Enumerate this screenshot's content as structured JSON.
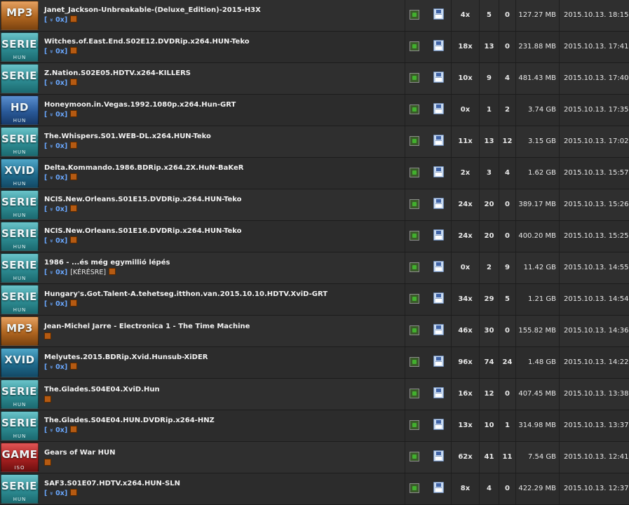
{
  "torrents": [
    {
      "cat": "MP3",
      "sub": "",
      "cls": "mp3",
      "name": "Janet_Jackson-Unbreakable-(Deluxe_Edition)-2015-H3X",
      "dl": "0x",
      "req": "",
      "downloads": "4x",
      "seeders": "5",
      "leechers": "0",
      "size": "127.27 MB",
      "date": "2015.10.13. 18:15"
    },
    {
      "cat": "SERIES",
      "sub": "HUN",
      "cls": "series",
      "name": "Witches.of.East.End.S02E12.DVDRip.x264.HUN-Teko",
      "dl": "0x",
      "req": "",
      "downloads": "18x",
      "seeders": "13",
      "leechers": "0",
      "size": "231.88 MB",
      "date": "2015.10.13. 17:41"
    },
    {
      "cat": "SERIES",
      "sub": "",
      "cls": "series",
      "name": "Z.Nation.S02E05.HDTV.x264-KILLERS",
      "dl": "0x",
      "req": "",
      "downloads": "10x",
      "seeders": "9",
      "leechers": "4",
      "size": "481.43 MB",
      "date": "2015.10.13. 17:40"
    },
    {
      "cat": "HD",
      "sub": "HUN",
      "cls": "hd",
      "name": "Honeymoon.in.Vegas.1992.1080p.x264.Hun-GRT",
      "dl": "0x",
      "req": "",
      "downloads": "0x",
      "seeders": "1",
      "leechers": "2",
      "size": "3.74 GB",
      "date": "2015.10.13. 17:35"
    },
    {
      "cat": "SERIES",
      "sub": "HUN",
      "cls": "series",
      "name": "The.Whispers.S01.WEB-DL.x264.HUN-Teko",
      "dl": "0x",
      "req": "",
      "downloads": "11x",
      "seeders": "13",
      "leechers": "12",
      "size": "3.15 GB",
      "date": "2015.10.13. 17:02"
    },
    {
      "cat": "XVID",
      "sub": "HUN",
      "cls": "xvid",
      "name": "Delta.Kommando.1986.BDRip.x264.2X.HuN-BaKeR",
      "dl": "0x",
      "req": "",
      "downloads": "2x",
      "seeders": "3",
      "leechers": "4",
      "size": "1.62 GB",
      "date": "2015.10.13. 15:57"
    },
    {
      "cat": "SERIES",
      "sub": "HUN",
      "cls": "series",
      "name": "NCIS.New.Orleans.S01E15.DVDRip.x264.HUN-Teko",
      "dl": "0x",
      "req": "",
      "downloads": "24x",
      "seeders": "20",
      "leechers": "0",
      "size": "389.17 MB",
      "date": "2015.10.13. 15:26"
    },
    {
      "cat": "SERIES",
      "sub": "HUN",
      "cls": "series",
      "name": "NCIS.New.Orleans.S01E16.DVDRip.x264.HUN-Teko",
      "dl": "0x",
      "req": "",
      "downloads": "24x",
      "seeders": "20",
      "leechers": "0",
      "size": "400.20 MB",
      "date": "2015.10.13. 15:25"
    },
    {
      "cat": "SERIES",
      "sub": "HUN",
      "cls": "series",
      "name": "1986 - ...és még egymillió lépés",
      "dl": "0x",
      "req": "[KÉRÉSRE]",
      "downloads": "0x",
      "seeders": "2",
      "leechers": "9",
      "size": "11.42 GB",
      "date": "2015.10.13. 14:55"
    },
    {
      "cat": "SERIES",
      "sub": "HUN",
      "cls": "series",
      "name": "Hungary's.Got.Talent-A.tehetseg.itthon.van.2015.10.10.HDTV.XviD-GRT",
      "dl": "0x",
      "req": "",
      "downloads": "34x",
      "seeders": "29",
      "leechers": "5",
      "size": "1.21 GB",
      "date": "2015.10.13. 14:54"
    },
    {
      "cat": "MP3",
      "sub": "",
      "cls": "mp3",
      "name": "Jean-Michel Jarre - Electronica 1 - The Time Machine",
      "dl": "",
      "req": "",
      "downloads": "46x",
      "seeders": "30",
      "leechers": "0",
      "size": "155.82 MB",
      "date": "2015.10.13. 14:36"
    },
    {
      "cat": "XVID",
      "sub": "",
      "cls": "xvid",
      "name": "Melyutes.2015.BDRip.Xvid.Hunsub-XiDER",
      "dl": "0x",
      "req": "",
      "downloads": "96x",
      "seeders": "74",
      "leechers": "24",
      "size": "1.48 GB",
      "date": "2015.10.13. 14:22"
    },
    {
      "cat": "SERIES",
      "sub": "HUN",
      "cls": "series",
      "name": "The.Glades.S04E04.XviD.Hun",
      "dl": "",
      "req": "",
      "downloads": "16x",
      "seeders": "12",
      "leechers": "0",
      "size": "407.45 MB",
      "date": "2015.10.13. 13:38"
    },
    {
      "cat": "SERIES",
      "sub": "HUN",
      "cls": "series",
      "name": "The.Glades.S04E04.HUN.DVDRip.x264-HNZ",
      "dl": "0x",
      "req": "",
      "downloads": "13x",
      "seeders": "10",
      "leechers": "1",
      "size": "314.98 MB",
      "date": "2015.10.13. 13:37"
    },
    {
      "cat": "GAME",
      "sub": "ISO",
      "cls": "game",
      "name": "Gears of War HUN",
      "dl": "",
      "req": "",
      "downloads": "62x",
      "seeders": "41",
      "leechers": "11",
      "size": "7.54 GB",
      "date": "2015.10.13. 12:41"
    },
    {
      "cat": "SERIES",
      "sub": "HUN",
      "cls": "series",
      "name": "SAF3.S01E07.HDTV.x264.HUN-SLN",
      "dl": "0x",
      "req": "",
      "downloads": "8x",
      "seeders": "4",
      "leechers": "0",
      "size": "422.29 MB",
      "date": "2015.10.13. 12:37"
    }
  ],
  "icons": {
    "check": "check-icon",
    "save": "floppy-disk-icon",
    "bookmark": "bookmark-icon"
  }
}
